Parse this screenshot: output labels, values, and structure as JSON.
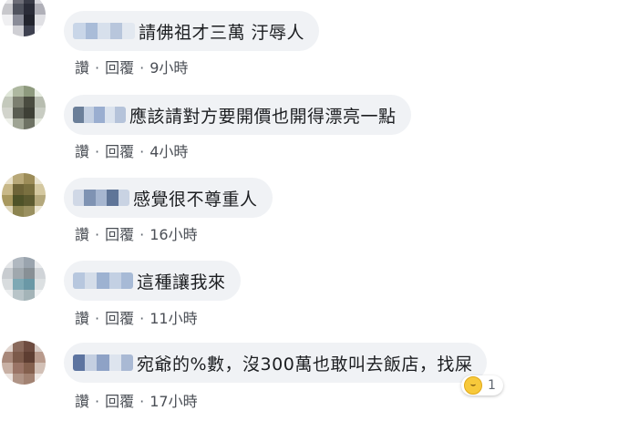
{
  "comments": [
    {
      "text": "請佛祖才三萬 汙辱人",
      "like": "讚",
      "reply": "回覆",
      "time": "9小時",
      "avatar_colors": [
        "#e8e8ea",
        "#6e6e78",
        "#3a3c48",
        "#d8d8de",
        "#c8c8cc",
        "#50535e",
        "#2a2c38",
        "#b0b0b8",
        "#f0f0f2",
        "#8a8c98",
        "#22242e",
        "#e0e0e4",
        "#ffffff",
        "#cfcfd4",
        "#3e4150",
        "#f4f4f6"
      ],
      "name_colors": [
        "#c9d6e8",
        "#a9bcd8",
        "#d7e0ec",
        "#b8c6dc",
        "#e2e8f0"
      ]
    },
    {
      "text": "應該請對方要開價也開得漂亮一點",
      "like": "讚",
      "reply": "回覆",
      "time": "4小時",
      "avatar_colors": [
        "#dfe6d8",
        "#aeb8a0",
        "#8e9a7e",
        "#e6ece0",
        "#c4c9bc",
        "#7c7f70",
        "#4a4c40",
        "#b8bdb0",
        "#d2d4cc",
        "#5a5d52",
        "#3e4036",
        "#c8ccc2",
        "#eef0ea",
        "#9fa494",
        "#6e7264",
        "#e4e8de"
      ],
      "name_colors": [
        "#6b7f99",
        "#c4d0e2",
        "#9aaed0",
        "#dbe3ee",
        "#b5c3da"
      ]
    },
    {
      "text": "感覺很不尊重人",
      "like": "讚",
      "reply": "回覆",
      "time": "16小時",
      "avatar_colors": [
        "#e8e0c8",
        "#b8a878",
        "#9c8c58",
        "#eae4d0",
        "#c8b888",
        "#6e6438",
        "#7a7040",
        "#d4c8a0",
        "#a8985e",
        "#4e5228",
        "#5c5a30",
        "#b4a87c",
        "#e0d8bc",
        "#8c8450",
        "#9a9060",
        "#ece6d2"
      ],
      "name_colors": [
        "#d0d8e6",
        "#7f93b3",
        "#a6b6d0",
        "#5f7598",
        "#c9d3e3"
      ]
    },
    {
      "text": "這種讓我來",
      "like": "讚",
      "reply": "回覆",
      "time": "11小時",
      "avatar_colors": [
        "#e4e6e8",
        "#b0b8c0",
        "#9aa4ae",
        "#e8eaec",
        "#c8ccd0",
        "#a0a8ae",
        "#889096",
        "#d0d4d8",
        "#d8dcde",
        "#7ea8b4",
        "#6a98a6",
        "#dce0e2",
        "#eceeef",
        "#b8c4c8",
        "#a4b4b8",
        "#f0f2f3"
      ],
      "name_colors": [
        "#b7c7de",
        "#d4dde9",
        "#9db2d1",
        "#c3d0e3",
        "#a7bad6"
      ]
    },
    {
      "text": "宛爺的%數，沒300萬也敢叫去飯店，找屎",
      "like": "讚",
      "reply": "回覆",
      "time": "17小時",
      "avatar_colors": [
        "#e2d6d0",
        "#8a6a5c",
        "#6e4c40",
        "#d8ccc6",
        "#a8887a",
        "#7c5a4a",
        "#5e3e32",
        "#b89a8c",
        "#c8b0a4",
        "#9a7466",
        "#84604e",
        "#d2c0b6",
        "#ece4e0",
        "#b09486",
        "#a28272",
        "#efe8e4"
      ],
      "name_colors": [
        "#5d74a0",
        "#c4cfe1",
        "#8ea2c6",
        "#dde4ee",
        "#a9b9d4"
      ],
      "reaction": {
        "icon": "haha-emoji-icon",
        "count": "1"
      }
    }
  ]
}
